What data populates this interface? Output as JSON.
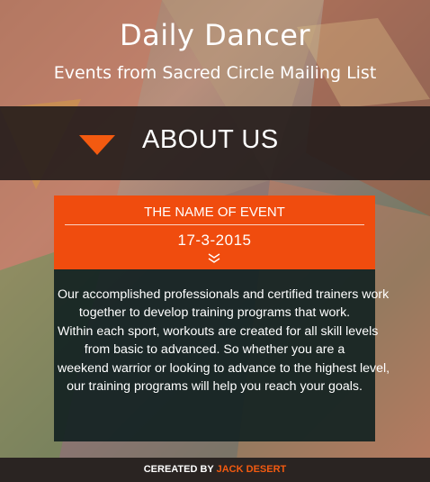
{
  "header": {
    "title": "Daily Dancer",
    "subtitle": "Events from Sacred Circle Mailing List"
  },
  "about": {
    "title": "ABOUT US",
    "arrow_icon": "triangle-down-icon",
    "arrow_color": "#f35a10"
  },
  "event": {
    "name": "THE NAME OF EVENT",
    "date": "17-3-2015",
    "expand_icon": "double-chevron-down-icon",
    "description_lines": [
      "Our accomplished professionals and certified trainers work",
      "together to develop training programs that work.",
      "Within each sport, workouts are created for all skill levels",
      "from basic to advanced. So whether you are a",
      "weekend warrior or looking to advance to the highest level,",
      "our training programs will help you reach your goals."
    ],
    "accent_color": "#f04c0e"
  },
  "footer": {
    "prefix": "CEREATED BY",
    "author": "JACK DESERT"
  }
}
